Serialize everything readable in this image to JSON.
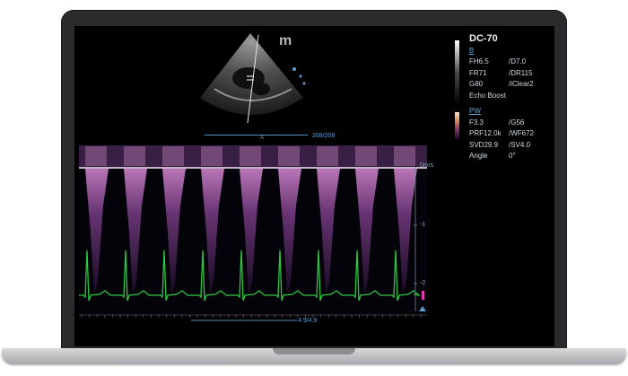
{
  "brand_logo": "m",
  "status": {
    "preset": "DC-70",
    "b_mode_label": "B",
    "b_params": [
      {
        "left": "FH6.5",
        "right": "/D7.0"
      },
      {
        "left": "FR71",
        "right": "/DR115"
      },
      {
        "left": "G80",
        "right": "/iClear2"
      }
    ],
    "echo_boost": "Echo Boost",
    "pw_mode_label": "PW",
    "pw_params": [
      {
        "left": "F3.3",
        "right": "/G56"
      },
      {
        "left": "PRF12.0k",
        "right": "/WF672"
      },
      {
        "left": "SVD29.9",
        "right": "/SV4.0"
      },
      {
        "left": "Angle",
        "right": "0°"
      }
    ]
  },
  "depth_readout": "208/208",
  "depth_marker": "A",
  "time_readout": "4.9/4.9",
  "velocity_scale": {
    "unit_label": "0m/s",
    "ticks": [
      "-1",
      "-2"
    ]
  },
  "colors": {
    "accent": "#5a9bd0",
    "doppler": "#a15ca8",
    "ecg": "#2ec742",
    "bezel": "#2b2b2d"
  }
}
